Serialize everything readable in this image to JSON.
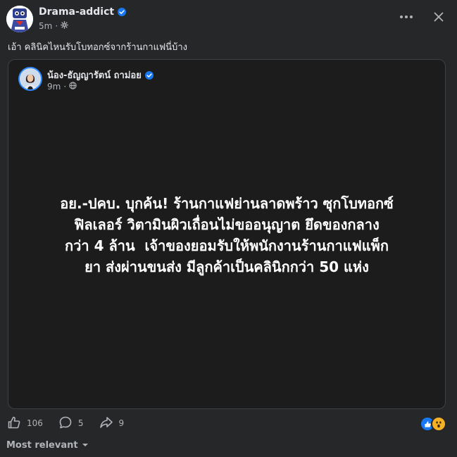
{
  "post": {
    "author_name": "Drama-addict",
    "time": "5m",
    "meta_separator": "·",
    "caption": "เอ้า คลินิคไหนรับโบทอกซ์จากร้านกาแฟนี่บ้าง"
  },
  "shared_post": {
    "author_name": "น้อง-ธัญญารัตน์ ถาม่อย",
    "time": "9m",
    "meta_separator": "·",
    "headline": "อย.-ปคบ. บุกค้น! ร้านกาแฟย่านลาดพร้าว ซุกโบทอกซ์\nฟิลเลอร์￼ วิตามินผิวเถื่อนไม่ขออนุญาต ยึดของกลาง\nกว่า 4 ล้าน ￼ เจ้าของยอมรับให้พนักงานร้านกาแฟแพ็ก\nยา￼ ส่งผ่านขนส่ง มีลูกค้าเป็นคลินิกกว่า 50 แห่ง"
  },
  "engagement": {
    "likes": "106",
    "comments": "5",
    "shares": "9"
  },
  "comments_sort": {
    "label": "Most relevant"
  },
  "icons": {
    "more": "more-horizontal-icon",
    "close": "close-icon",
    "audience": "settings-gear-icon",
    "shared_audience": "globe-icon",
    "like": "thumbs-up-icon",
    "comment": "comment-bubble-icon",
    "share": "share-arrow-icon",
    "reaction_like": "like-reaction-icon",
    "reaction_wow": "wow-reaction-icon",
    "sort": "chevron-down-icon"
  },
  "colors": {
    "background": "#252728",
    "card": "#1c1c1d",
    "verified": "#1877f2",
    "text_primary": "#e4e6eb",
    "text_secondary": "#b0b3b8"
  }
}
